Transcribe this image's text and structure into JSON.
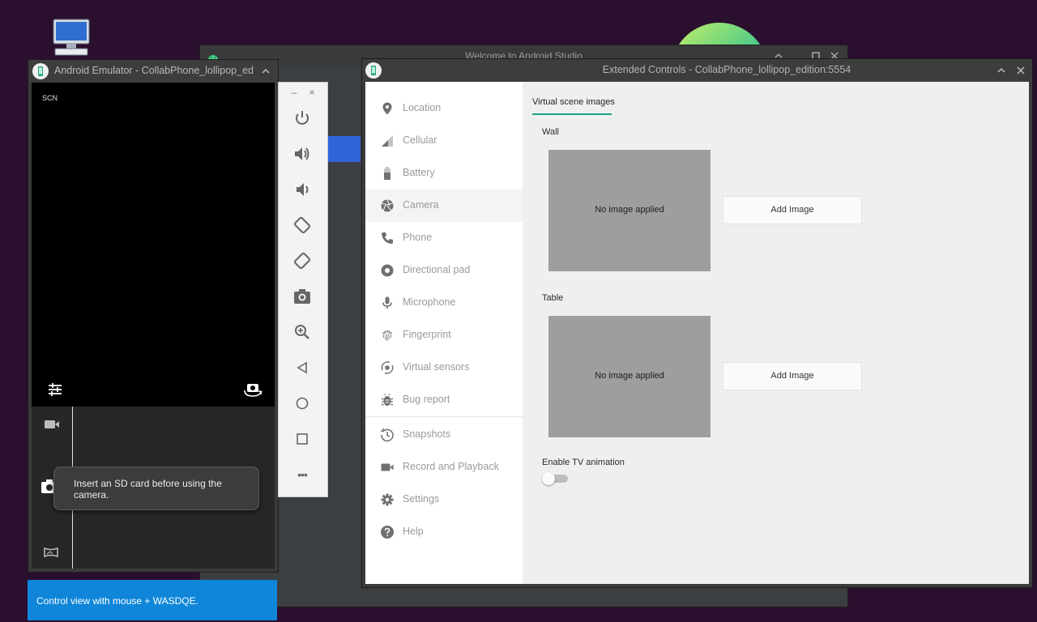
{
  "colors": {
    "desktop_bg": "#2a0f2e",
    "accent_teal": "#1aa38a",
    "tooltip_blue": "#0f86d9",
    "studio_highlight": "#2f63d8"
  },
  "studio": {
    "title": "Welcome to Android Studio"
  },
  "emulator": {
    "title": "Android Emulator - CollabPhone_lollipop_ed",
    "screen_label": "SCN",
    "snackbar_text": "Insert an SD card before using the camera."
  },
  "tooltip": {
    "text": "Control view with mouse + WASDQE."
  },
  "side_toolbar": {
    "buttons": [
      "power-icon",
      "volume-up-icon",
      "volume-down-icon",
      "rotate-left-icon",
      "rotate-right-icon",
      "camera-icon",
      "zoom-icon",
      "back-icon",
      "home-icon",
      "overview-icon",
      "more-icon"
    ],
    "minimize": "–",
    "close": "×",
    "more": "•••"
  },
  "extended_controls": {
    "title": "Extended Controls - CollabPhone_lollipop_edition:5554",
    "nav": [
      {
        "label": "Location",
        "icon": "location-icon"
      },
      {
        "label": "Cellular",
        "icon": "cellular-icon"
      },
      {
        "label": "Battery",
        "icon": "battery-icon"
      },
      {
        "label": "Camera",
        "icon": "camera-aperture-icon",
        "active": true
      },
      {
        "label": "Phone",
        "icon": "phone-icon"
      },
      {
        "label": "Directional pad",
        "icon": "dpad-icon"
      },
      {
        "label": "Microphone",
        "icon": "microphone-icon"
      },
      {
        "label": "Fingerprint",
        "icon": "fingerprint-icon"
      },
      {
        "label": "Virtual sensors",
        "icon": "virtual-sensors-icon"
      },
      {
        "label": "Bug report",
        "icon": "bug-icon"
      },
      {
        "label": "Snapshots",
        "icon": "snapshots-icon"
      },
      {
        "label": "Record and Playback",
        "icon": "record-icon"
      },
      {
        "label": "Settings",
        "icon": "settings-icon"
      },
      {
        "label": "Help",
        "icon": "help-icon"
      }
    ],
    "tab": "Virtual scene images",
    "wall": {
      "label": "Wall",
      "image_text": "No image applied",
      "button": "Add Image"
    },
    "table": {
      "label": "Table",
      "image_text": "No image applied",
      "button": "Add Image"
    },
    "tv_animation": {
      "label": "Enable TV animation",
      "enabled": false
    }
  }
}
